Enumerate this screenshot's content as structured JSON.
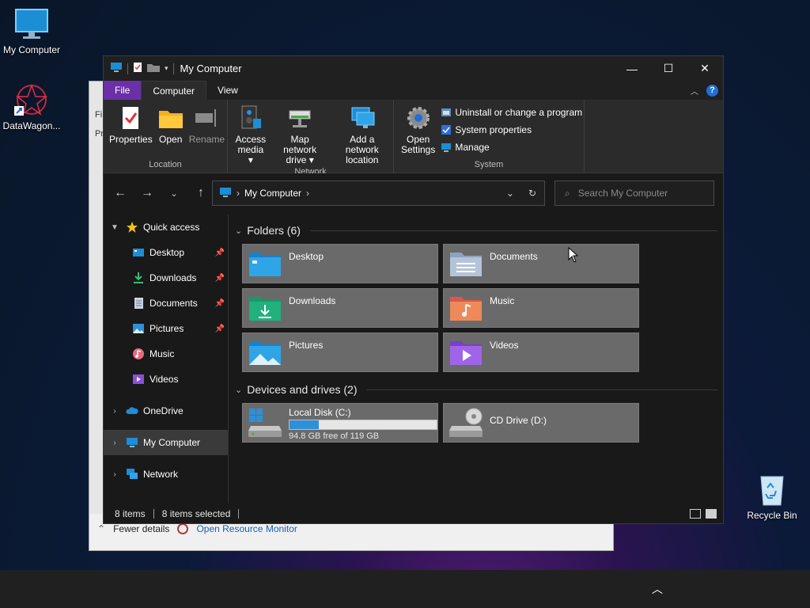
{
  "desktop": {
    "icons": [
      {
        "label": "My Computer"
      },
      {
        "label": "DataWagon..."
      },
      {
        "label": "Recycle Bin"
      }
    ]
  },
  "background_window": {
    "left_fragments": [
      "Fi",
      "Pr"
    ],
    "fewer_details": "Fewer details",
    "open_resource_monitor": "Open Resource Monitor"
  },
  "window": {
    "title": "My Computer",
    "controls": {
      "minimize": "—",
      "maximize": "☐",
      "close": "✕"
    },
    "tabs": [
      "File",
      "Computer",
      "View"
    ],
    "ribbon": {
      "location": {
        "label": "Location",
        "buttons": [
          "Properties",
          "Open",
          "Rename"
        ]
      },
      "network": {
        "label": "Network",
        "buttons": [
          {
            "line1": "Access",
            "line2": "media ▾"
          },
          {
            "line1": "Map network",
            "line2": "drive ▾"
          },
          {
            "line1": "Add a network",
            "line2": "location"
          }
        ]
      },
      "system": {
        "label": "System",
        "open_settings": {
          "line1": "Open",
          "line2": "Settings"
        },
        "links": [
          "Uninstall or change a program",
          "System properties",
          "Manage"
        ]
      }
    },
    "address": {
      "path": "My Computer",
      "search_placeholder": "Search My Computer"
    },
    "nav": {
      "quick_access": "Quick access",
      "quick_items": [
        "Desktop",
        "Downloads",
        "Documents",
        "Pictures",
        "Music",
        "Videos"
      ],
      "onedrive": "OneDrive",
      "my_computer": "My Computer",
      "network": "Network"
    },
    "content": {
      "folders_header": "Folders (6)",
      "folders": [
        "Desktop",
        "Documents",
        "Downloads",
        "Music",
        "Pictures",
        "Videos"
      ],
      "devices_header": "Devices and drives (2)",
      "drives": [
        {
          "name": "Local Disk (C:)",
          "free_text": "94.8 GB free of 119 GB",
          "used_fraction": 0.2
        },
        {
          "name": "CD Drive (D:)"
        }
      ]
    },
    "status": {
      "items": "8 items",
      "selected": "8 items selected"
    }
  },
  "colors": {
    "file_tab": "#6b2fa8",
    "drive_bar": "#2f8fd8",
    "tile_bg": "#6a6a6a"
  }
}
